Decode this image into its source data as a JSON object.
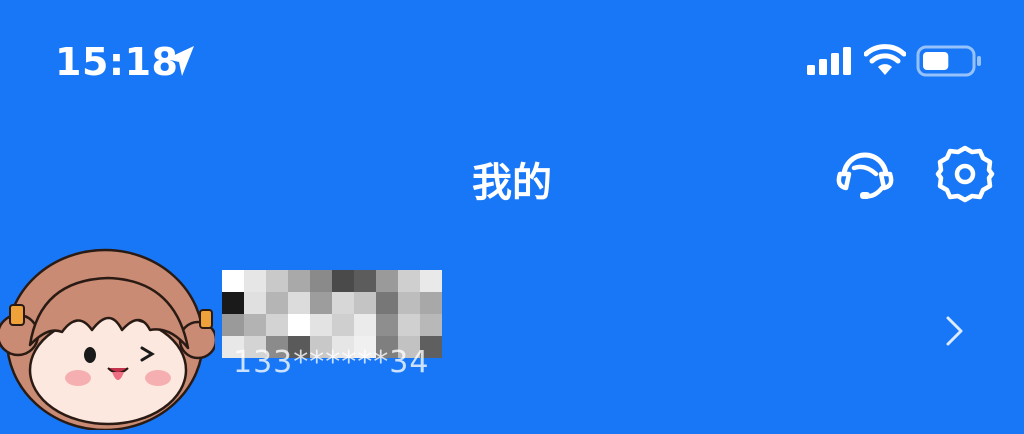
{
  "status_bar": {
    "time": "15:18",
    "icons": [
      "location-arrow-icon",
      "signal-icon",
      "wifi-icon",
      "battery-icon"
    ],
    "battery_level": 0.55
  },
  "header": {
    "title": "我的",
    "actions": [
      {
        "name": "customer-service-icon"
      },
      {
        "name": "settings-gear-icon"
      }
    ]
  },
  "profile": {
    "phone": "133******34",
    "username_obscured": true,
    "avatar": "cartoon-girl-avatar"
  },
  "colors": {
    "background": "#1777F7",
    "text": "#FFFFFF"
  }
}
